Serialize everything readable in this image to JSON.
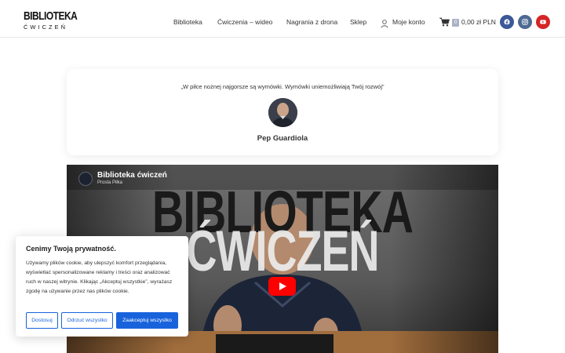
{
  "header": {
    "logo_top": "BIBLIOTEKA",
    "logo_bottom": "ĆWICZEŃ",
    "nav": [
      {
        "label": "Biblioteka"
      },
      {
        "label": "Ćwiczenia – wideo"
      },
      {
        "label": "Nagrania z drona"
      },
      {
        "label": "Sklep"
      },
      {
        "label": "Moje konto"
      }
    ],
    "cart": {
      "count": "0",
      "total": "0,00 zł PLN",
      "icon": "cart-icon"
    },
    "social": [
      {
        "name": "facebook-icon",
        "color": "#3b5998"
      },
      {
        "name": "instagram-icon",
        "color": "#4e6a93"
      },
      {
        "name": "youtube-icon",
        "color": "#d62525"
      }
    ]
  },
  "quote": {
    "text": "„W piłce nożnej najgorsze są wymówki. Wymówki uniemożliwiają Twój rozwój”",
    "author": "Pep Guardiola"
  },
  "video": {
    "title": "Biblioteka ćwiczeń",
    "channel": "Prosta Piłka",
    "overlay_line1": "BIBLIOTEKA",
    "overlay_line2": "ĆWICZEŃ"
  },
  "cookie": {
    "title": "Cenimy Twoją prywatność.",
    "body": "Używamy plików cookie, aby ulepszyć komfort przeglądania, wyświetlać spersonalizowane reklamy i treści oraz analizować ruch w naszej witrynie. Klikając „Akceptuj wszystkie”, wyrażasz zgodę na używanie przez nas plików cookie.",
    "customize_label": "Dostosuj",
    "reject_label": "Odrzuć wszystko",
    "accept_label": "Zaakceptuj wszystko",
    "accent_color": "#1863dc"
  }
}
